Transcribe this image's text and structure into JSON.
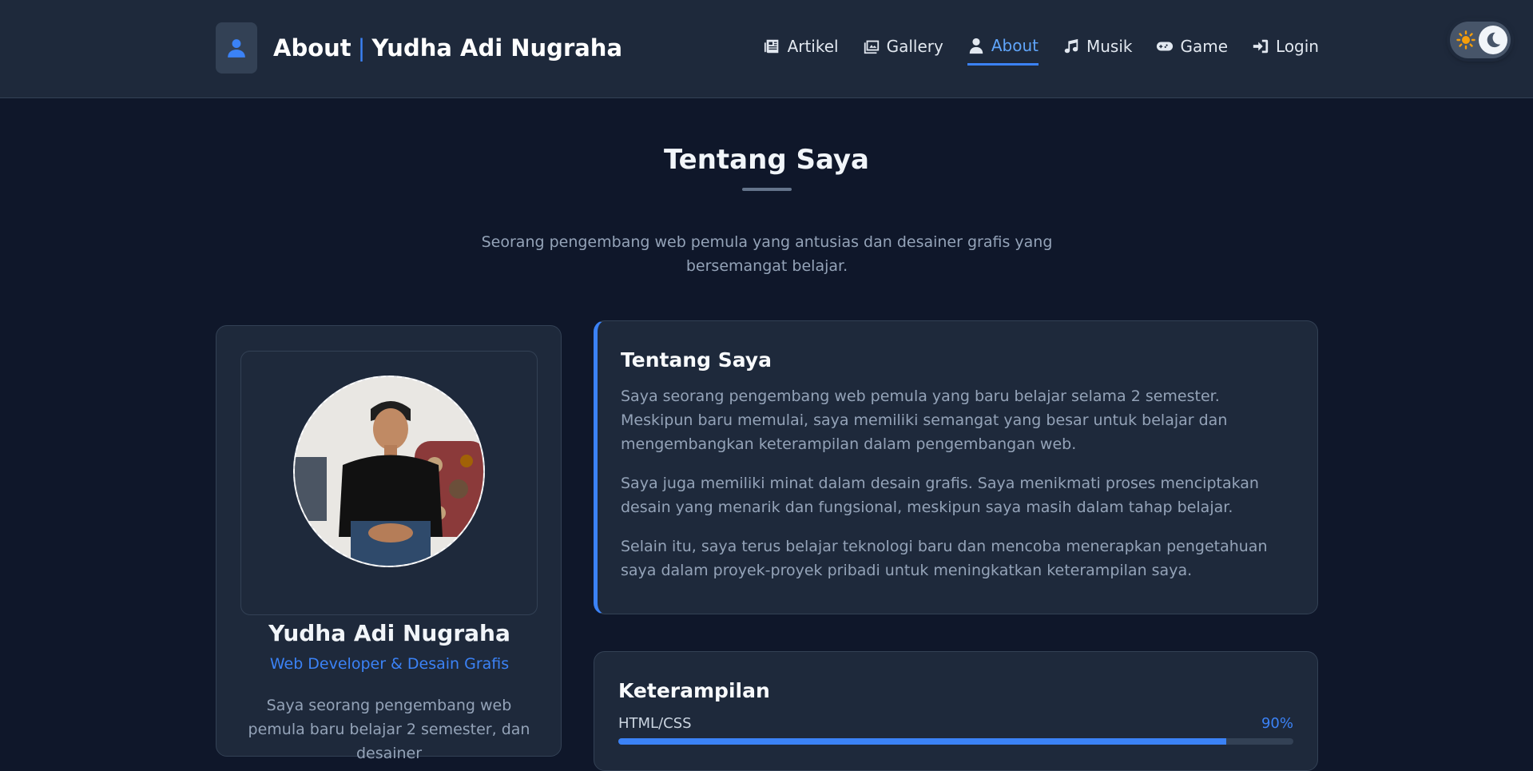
{
  "header": {
    "brand_title": "About",
    "brand_separator": "|",
    "brand_name": "Yudha Adi Nugraha",
    "nav": [
      {
        "label": "Artikel",
        "icon": "newspaper-icon"
      },
      {
        "label": "Gallery",
        "icon": "images-icon"
      },
      {
        "label": "About",
        "icon": "user-icon",
        "active": true
      },
      {
        "label": "Musik",
        "icon": "music-icon"
      },
      {
        "label": "Game",
        "icon": "gamepad-icon"
      },
      {
        "label": "Login",
        "icon": "sign-in-icon"
      }
    ],
    "theme_toggle": {
      "mode": "dark",
      "icons": [
        "sun-icon",
        "moon-icon"
      ]
    }
  },
  "hero": {
    "title": "Tentang Saya",
    "subtitle": "Seorang pengembang web pemula yang antusias dan desainer grafis yang bersemangat belajar."
  },
  "profile": {
    "name": "Yudha Adi Nugraha",
    "role": "Web Developer & Desain Grafis",
    "bio": "Saya seorang pengembang web pemula baru belajar 2 semester, dan desainer"
  },
  "about": {
    "title": "Tentang Saya",
    "paragraphs": [
      "Saya seorang pengembang web pemula yang baru belajar selama 2 semester. Meskipun baru memulai, saya memiliki semangat yang besar untuk belajar dan mengembangkan keterampilan dalam pengembangan web.",
      "Saya juga memiliki minat dalam desain grafis. Saya menikmati proses menciptakan desain yang menarik dan fungsional, meskipun saya masih dalam tahap belajar.",
      "Selain itu, saya terus belajar teknologi baru dan mencoba menerapkan pengetahuan saya dalam proyek-proyek pribadi untuk meningkatkan keterampilan saya."
    ]
  },
  "skills": {
    "title": "Keterampilan",
    "items": [
      {
        "name": "HTML/CSS",
        "percent_label": "90%",
        "level": 0.9
      }
    ]
  },
  "colors": {
    "background": "#0f172a",
    "card": "#1e293b",
    "accent": "#3b82f6",
    "muted_text": "#94a3b8"
  }
}
